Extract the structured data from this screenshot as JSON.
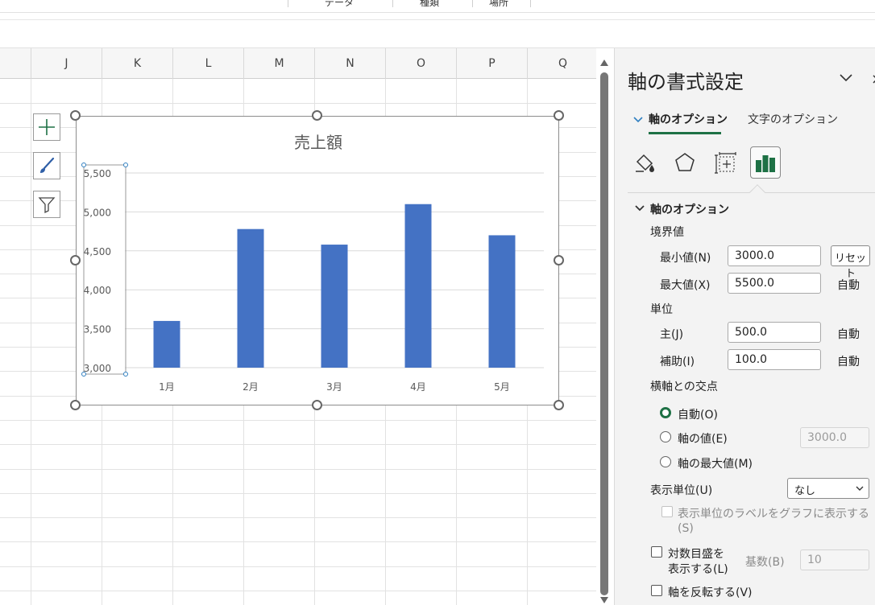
{
  "ribbon": {
    "groups": [
      "データ",
      "種類",
      "場所"
    ]
  },
  "sheet": {
    "columns": [
      "J",
      "K",
      "L",
      "M",
      "N",
      "O",
      "P",
      "Q"
    ]
  },
  "chart": {
    "title": "売上額"
  },
  "chart_data": {
    "type": "bar",
    "title": "売上額",
    "categories": [
      "1月",
      "2月",
      "3月",
      "4月",
      "5月"
    ],
    "values": [
      3600,
      4780,
      4580,
      5100,
      4700
    ],
    "ylim": [
      3000,
      5500
    ],
    "yticks": [
      "3,000",
      "3,500",
      "4,000",
      "4,500",
      "5,000",
      "5,500"
    ],
    "ytick_values": [
      3000,
      3500,
      4000,
      4500,
      5000,
      5500
    ],
    "grid": true,
    "bar_color": "#4472c4"
  },
  "pane": {
    "title": "軸の書式設定",
    "tab_axis": "軸のオプション",
    "tab_text": "文字のオプション",
    "section": "軸のオプション",
    "bounds_label": "境界値",
    "min_label": "最小値(N)",
    "min_value": "3000.0",
    "reset_label": "リセット",
    "max_label": "最大値(X)",
    "max_value": "5500.0",
    "auto_label": "自動",
    "units_label": "単位",
    "major_label": "主(J)",
    "major_value": "500.0",
    "minor_label": "補助(I)",
    "minor_value": "100.0",
    "cross_label": "横軸との交点",
    "cross_auto": "自動(O)",
    "cross_value_label": "軸の値(E)",
    "cross_value": "3000.0",
    "cross_max": "軸の最大値(M)",
    "display_unit_label": "表示単位(U)",
    "display_unit_value": "なし",
    "display_unit_show": "表示単位のラベルをグラフに表示する",
    "display_unit_show_key": "(S)",
    "log_line1": "対数目盛を",
    "log_line2": "表示する(L)",
    "base_label": "基数(B)",
    "base_value": "10",
    "reverse_label": "軸を反転する(V)"
  },
  "colors": {
    "accent": "#1e7145",
    "bar": "#4472c4"
  }
}
